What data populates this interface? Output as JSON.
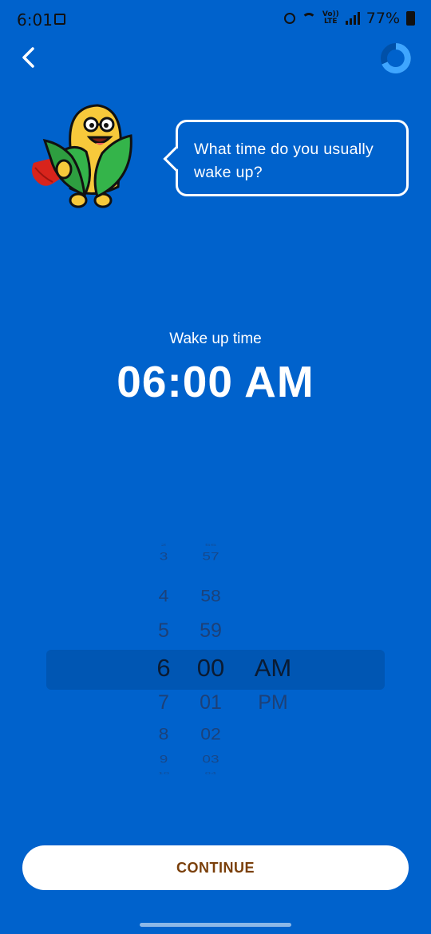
{
  "status_bar": {
    "time": "6:01",
    "volte_top": "Vo))",
    "volte_bottom": "LTE",
    "battery": "77%"
  },
  "prompt": {
    "text": "What time do you usually wake up?"
  },
  "wake": {
    "label": "Wake up time",
    "value": "06:00 AM"
  },
  "picker": {
    "hours": [
      "2",
      "3",
      "4",
      "5",
      "6",
      "7",
      "8",
      "9",
      "10"
    ],
    "minutes": [
      "56",
      "57",
      "58",
      "59",
      "00",
      "01",
      "02",
      "03",
      "04"
    ],
    "periods": [
      "AM",
      "PM"
    ],
    "selected": {
      "hour": "6",
      "minute": "00",
      "period": "AM"
    }
  },
  "continue_label": "CONTINUE",
  "colors": {
    "background": "#0062CC",
    "button_text": "#7A3F0A",
    "progress_ring": "#3FA6FF"
  }
}
